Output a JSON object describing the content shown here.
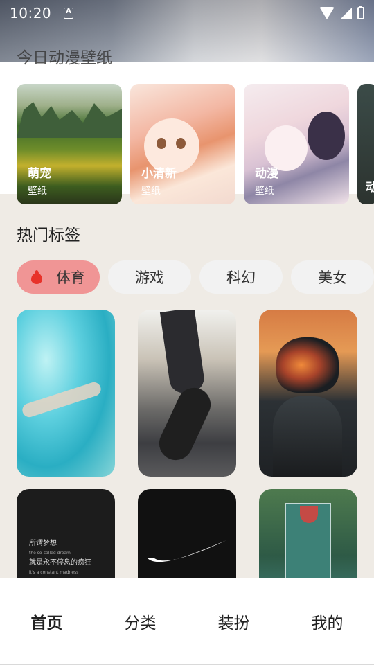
{
  "status_bar": {
    "time": "10:20"
  },
  "top_title_faded": "今日动漫壁纸",
  "carousel": [
    {
      "title": "萌宠",
      "subtitle": "壁纸"
    },
    {
      "title": "小清新",
      "subtitle": "壁纸"
    },
    {
      "title": "动漫",
      "subtitle": "壁纸"
    },
    {
      "title": "动"
    }
  ],
  "hot_tags": {
    "title": "热门标签",
    "chips": [
      {
        "label": "体育",
        "active": true,
        "icon": "fire-icon"
      },
      {
        "label": "游戏"
      },
      {
        "label": "科幻"
      },
      {
        "label": "美女"
      }
    ]
  },
  "wallpaper_texts": {
    "quote_line1": "所谓梦想",
    "quote_line1_en": "the so-called dream",
    "quote_line2": "就是永不停息的疯狂",
    "quote_line2_en": "it's a constant madness"
  },
  "bottom_nav": [
    {
      "label": "首页",
      "active": true
    },
    {
      "label": "分类"
    },
    {
      "label": "装扮"
    },
    {
      "label": "我的"
    }
  ],
  "colors": {
    "active_chip": "#f09595",
    "fire": "#e8322a",
    "page_bg": "#efebe5"
  }
}
